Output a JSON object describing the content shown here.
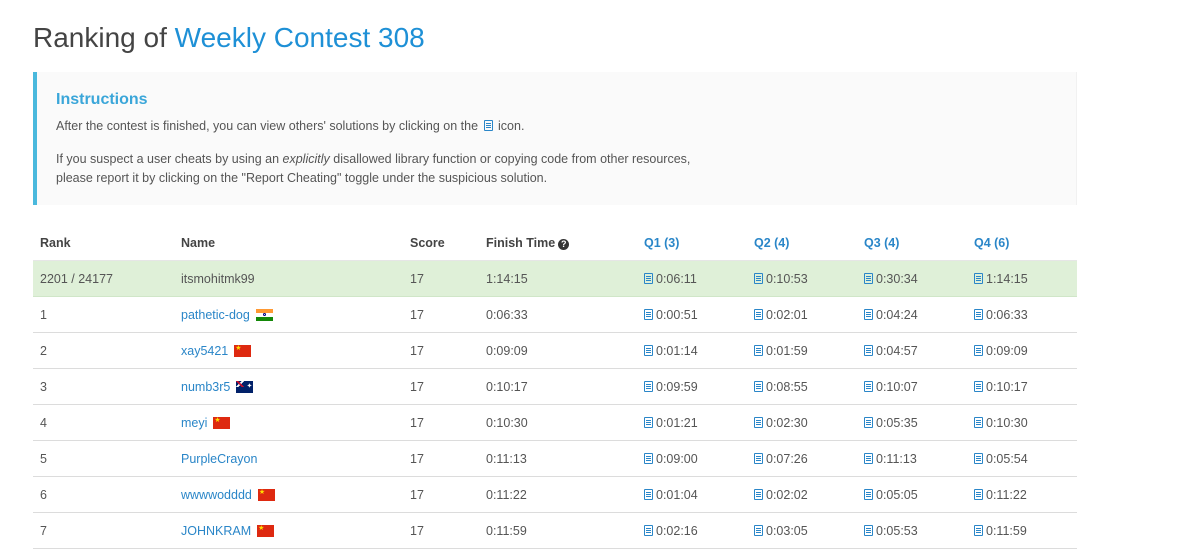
{
  "header": {
    "title_prefix": "Ranking of",
    "contest_name": "Weekly Contest 308"
  },
  "instructions": {
    "title": "Instructions",
    "p1_before": "After the contest is finished, you can view others' solutions by clicking on the",
    "p1_after": "icon.",
    "p2_a": "If you suspect a user cheats by using an",
    "p2_em": "explicitly",
    "p2_b": "disallowed library function or copying code from other resources,",
    "p2_c": "please report it by clicking on the \"Report Cheating\" toggle under the suspicious solution."
  },
  "table": {
    "headers": {
      "rank": "Rank",
      "name": "Name",
      "score": "Score",
      "finish_time": "Finish Time",
      "q1": "Q1 (3)",
      "q2": "Q2 (4)",
      "q3": "Q3 (4)",
      "q4": "Q4 (6)"
    },
    "rows": [
      {
        "rank": "2201 / 24177",
        "name": "itsmohitmk99",
        "flag": "",
        "score": "17",
        "finish": "1:14:15",
        "q1": "0:06:11",
        "q2": "0:10:53",
        "q3": "0:30:34",
        "q4": "1:14:15"
      },
      {
        "rank": "1",
        "name": "pathetic-dog",
        "flag": "india-flag-icon",
        "score": "17",
        "finish": "0:06:33",
        "q1": "0:00:51",
        "q2": "0:02:01",
        "q3": "0:04:24",
        "q4": "0:06:33"
      },
      {
        "rank": "2",
        "name": "xay5421",
        "flag": "china-flag-icon",
        "score": "17",
        "finish": "0:09:09",
        "q1": "0:01:14",
        "q2": "0:01:59",
        "q3": "0:04:57",
        "q4": "0:09:09"
      },
      {
        "rank": "3",
        "name": "numb3r5",
        "flag": "australia-flag-icon",
        "score": "17",
        "finish": "0:10:17",
        "q1": "0:09:59",
        "q2": "0:08:55",
        "q3": "0:10:07",
        "q4": "0:10:17"
      },
      {
        "rank": "4",
        "name": "meyi",
        "flag": "china-flag-icon",
        "score": "17",
        "finish": "0:10:30",
        "q1": "0:01:21",
        "q2": "0:02:30",
        "q3": "0:05:35",
        "q4": "0:10:30"
      },
      {
        "rank": "5",
        "name": "PurpleCrayon",
        "flag": "",
        "score": "17",
        "finish": "0:11:13",
        "q1": "0:09:00",
        "q2": "0:07:26",
        "q3": "0:11:13",
        "q4": "0:05:54"
      },
      {
        "rank": "6",
        "name": "wwwwodddd",
        "flag": "china-flag-icon",
        "score": "17",
        "finish": "0:11:22",
        "q1": "0:01:04",
        "q2": "0:02:02",
        "q3": "0:05:05",
        "q4": "0:11:22"
      },
      {
        "rank": "7",
        "name": "JOHNKRAM",
        "flag": "china-flag-icon",
        "score": "17",
        "finish": "0:11:59",
        "q1": "0:02:16",
        "q2": "0:03:05",
        "q3": "0:05:53",
        "q4": "0:11:59"
      }
    ]
  },
  "colors": {
    "accent": "#1e90d6",
    "instruction_border": "#4ab9dd",
    "highlight_row": "#dff0d8"
  }
}
